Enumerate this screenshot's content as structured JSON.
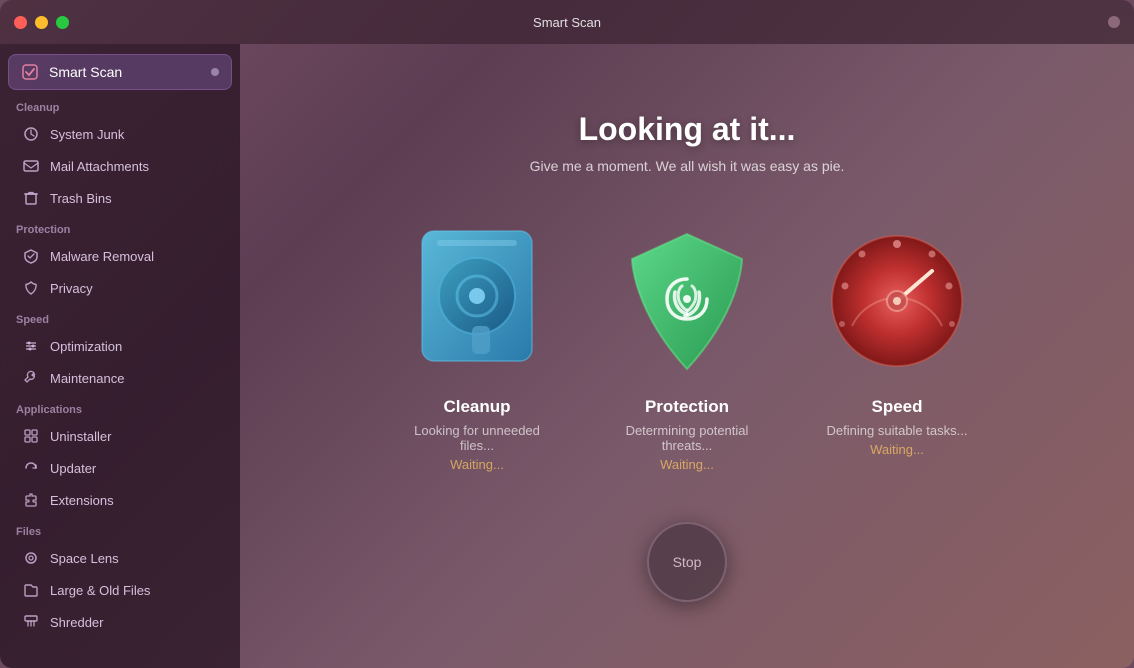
{
  "window": {
    "title": "Smart Scan"
  },
  "titlebar": {
    "buttons": {
      "close": "close",
      "minimize": "minimize",
      "maximize": "maximize"
    },
    "title": "Smart Scan"
  },
  "sidebar": {
    "smart_scan_label": "Smart Scan",
    "sections": [
      {
        "name": "cleanup",
        "label": "Cleanup",
        "items": [
          {
            "id": "system-junk",
            "label": "System Junk",
            "icon": "gear"
          },
          {
            "id": "mail-attachments",
            "label": "Mail Attachments",
            "icon": "envelope"
          },
          {
            "id": "trash-bins",
            "label": "Trash Bins",
            "icon": "trash"
          }
        ]
      },
      {
        "name": "protection",
        "label": "Protection",
        "items": [
          {
            "id": "malware-removal",
            "label": "Malware Removal",
            "icon": "bug"
          },
          {
            "id": "privacy",
            "label": "Privacy",
            "icon": "hand"
          }
        ]
      },
      {
        "name": "speed",
        "label": "Speed",
        "items": [
          {
            "id": "optimization",
            "label": "Optimization",
            "icon": "sliders"
          },
          {
            "id": "maintenance",
            "label": "Maintenance",
            "icon": "wrench"
          }
        ]
      },
      {
        "name": "applications",
        "label": "Applications",
        "items": [
          {
            "id": "uninstaller",
            "label": "Uninstaller",
            "icon": "grid"
          },
          {
            "id": "updater",
            "label": "Updater",
            "icon": "refresh"
          },
          {
            "id": "extensions",
            "label": "Extensions",
            "icon": "puzzle"
          }
        ]
      },
      {
        "name": "files",
        "label": "Files",
        "items": [
          {
            "id": "space-lens",
            "label": "Space Lens",
            "icon": "eye"
          },
          {
            "id": "large-old-files",
            "label": "Large & Old Files",
            "icon": "folder"
          },
          {
            "id": "shredder",
            "label": "Shredder",
            "icon": "shred"
          }
        ]
      }
    ]
  },
  "main": {
    "title": "Looking at it...",
    "subtitle": "Give me a moment. We all wish it was easy as pie.",
    "cards": [
      {
        "id": "cleanup",
        "name": "Cleanup",
        "status": "Looking for unneeded files...",
        "waiting": "Waiting..."
      },
      {
        "id": "protection",
        "name": "Protection",
        "status": "Determining potential threats...",
        "waiting": "Waiting..."
      },
      {
        "id": "speed",
        "name": "Speed",
        "status": "Defining suitable tasks...",
        "waiting": "Waiting..."
      }
    ],
    "stop_button_label": "Stop"
  },
  "colors": {
    "accent_purple": "#7a5090",
    "sidebar_bg": "rgba(40,20,35,0.75)",
    "cleanup_blue": "#4a9fc8",
    "protection_green": "#3cb86a",
    "speed_red": "#e05050"
  }
}
